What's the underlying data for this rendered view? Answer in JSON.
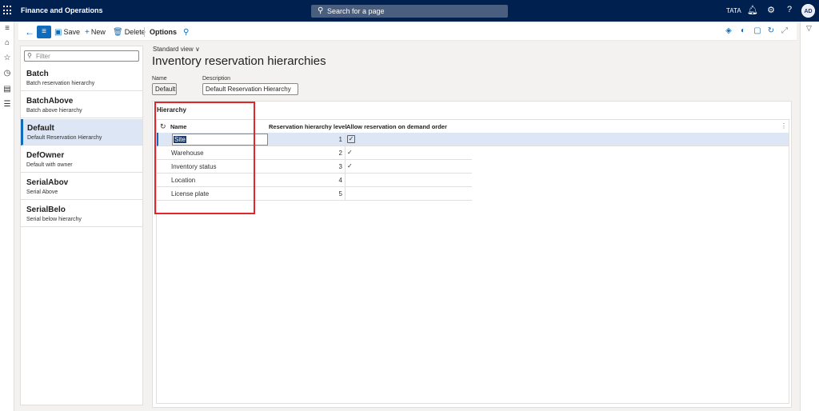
{
  "topbar": {
    "app_title": "Finance and Operations",
    "search_placeholder": "Search for a page",
    "company": "TATA",
    "avatar_initials": "AD"
  },
  "actions": {
    "save": "Save",
    "new": "New",
    "delete": "Delete",
    "options": "Options"
  },
  "filter": {
    "placeholder": "Filter"
  },
  "list": [
    {
      "title": "Batch",
      "subtitle": "Batch reservation hierarchy",
      "selected": false
    },
    {
      "title": "BatchAbove",
      "subtitle": "Batch above hierarchy",
      "selected": false
    },
    {
      "title": "Default",
      "subtitle": "Default Reservation Hierarchy",
      "selected": true
    },
    {
      "title": "DefOwner",
      "subtitle": "Default with owner",
      "selected": false
    },
    {
      "title": "SerialAbov",
      "subtitle": "Serial Above",
      "selected": false
    },
    {
      "title": "SerialBelo",
      "subtitle": "Serial below hierarchy",
      "selected": false
    }
  ],
  "main": {
    "view": "Standard view",
    "title": "Inventory reservation hierarchies",
    "name_label": "Name",
    "name_value": "Default",
    "description_label": "Description",
    "description_value": "Default Reservation Hierarchy",
    "section_title": "Hierarchy"
  },
  "grid": {
    "columns": {
      "name": "Name",
      "level": "Reservation hierarchy level",
      "allow": "Allow reservation on demand order"
    },
    "rows": [
      {
        "name": "Site",
        "level": "1",
        "allow": "checkbox",
        "selected": true
      },
      {
        "name": "Warehouse",
        "level": "2",
        "allow": "check",
        "selected": false
      },
      {
        "name": "Inventory status",
        "level": "3",
        "allow": "check",
        "selected": false
      },
      {
        "name": "Location",
        "level": "4",
        "allow": "",
        "selected": false
      },
      {
        "name": "License plate",
        "level": "5",
        "allow": "",
        "selected": false
      }
    ]
  },
  "colors": {
    "topbar": "#002050",
    "accent": "#0f6cbd",
    "selection": "#dde6f4",
    "annotation": "#e3262c"
  }
}
